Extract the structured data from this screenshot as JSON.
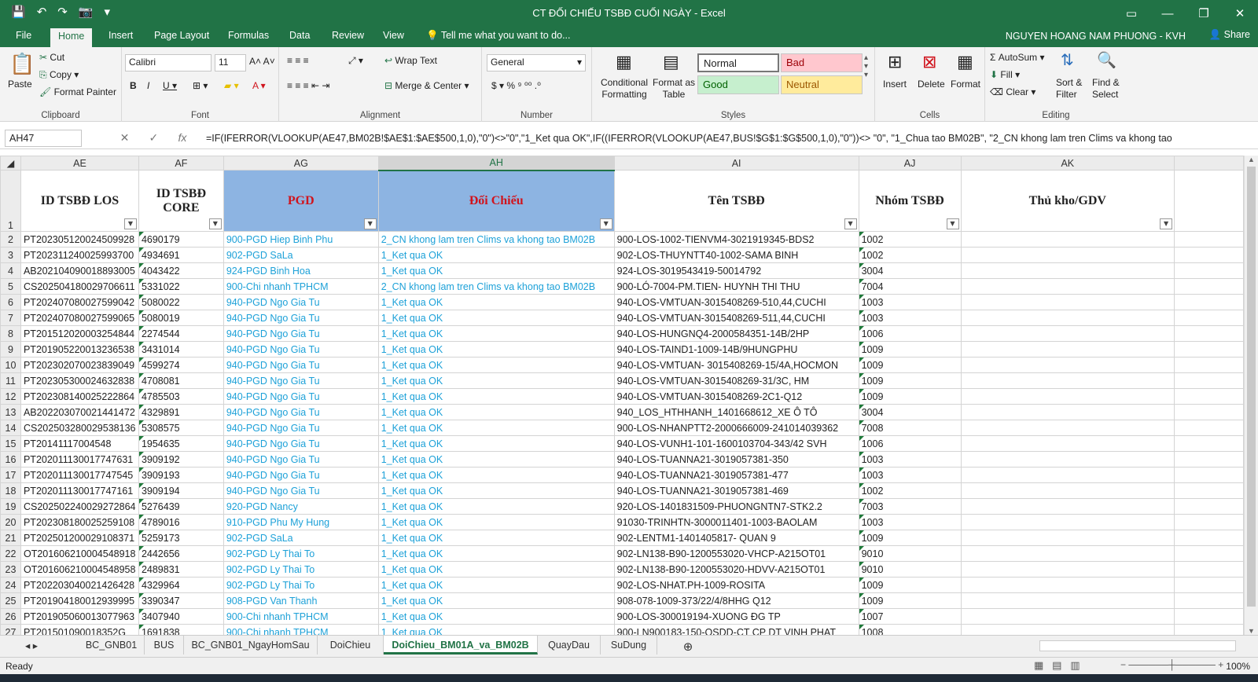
{
  "window": {
    "title": "CT ĐỐI CHIẾU TSBĐ CUỐI NGÀY - Excel"
  },
  "tabs": [
    "File",
    "Home",
    "Insert",
    "Page Layout",
    "Formulas",
    "Data",
    "Review",
    "View"
  ],
  "tell_me": "Tell me what you want to do...",
  "user": "NGUYEN HOANG NAM PHUONG - KVH",
  "share": "Share",
  "ribbon": {
    "clipboard": {
      "label": "Clipboard",
      "paste": "Paste",
      "cut": "Cut",
      "copy": "Copy",
      "format_painter": "Format Painter"
    },
    "font": {
      "label": "Font",
      "name": "Calibri",
      "size": "11"
    },
    "alignment": {
      "label": "Alignment",
      "wrap": "Wrap Text",
      "merge": "Merge & Center"
    },
    "number": {
      "label": "Number",
      "format": "General"
    },
    "styles": {
      "label": "Styles",
      "cond": "Conditional Formatting",
      "table": "Format as Table",
      "normal": "Normal",
      "bad": "Bad",
      "good": "Good",
      "neutral": "Neutral"
    },
    "cells": {
      "label": "Cells",
      "insert": "Insert",
      "delete": "Delete",
      "format": "Format"
    },
    "editing": {
      "label": "Editing",
      "autosum": "AutoSum",
      "fill": "Fill",
      "clear": "Clear",
      "sort": "Sort & Filter",
      "find": "Find & Select"
    }
  },
  "namebox": "AH47",
  "formula": "=IF(IFERROR(VLOOKUP(AE47,BM02B!$AE$1:$AE$500,1,0),\"0\")<>\"0\",\"1_Ket qua OK\",IF((IFERROR(VLOOKUP(AE47,BUS!$G$1:$G$500,1,0),\"0\"))<> \"0\", \"1_Chua tao BM02B\", \"2_CN khong lam tren Clims va khong tao",
  "columns": [
    "AE",
    "AF",
    "AG",
    "AH",
    "AI",
    "AJ",
    "AK"
  ],
  "headers": [
    "ID TSBĐ LOS",
    "ID TSBĐ CORE",
    "PGD",
    "Đối Chiếu",
    "Tên TSBĐ",
    "Nhóm TSBĐ",
    "Thủ kho/GDV"
  ],
  "rows": [
    [
      "PT202305120024509928",
      "4690179",
      "900-PGD Hiep Binh Phu",
      "2_CN khong lam tren Clims va khong tao BM02B",
      "900-LOS-1002-TIENVM4-3021919345-BDS2",
      "1002"
    ],
    [
      "PT202311240025993700",
      "4934691",
      "902-PGD SaLa",
      "1_Ket qua OK",
      "902-LOS-THUYNTT40-1002-SAMA BINH",
      "1002"
    ],
    [
      "AB202104090018893005",
      "4043422",
      "924-PGD Binh Hoa",
      "1_Ket qua OK",
      "924-LOS-3019543419-50014792",
      "3004"
    ],
    [
      "CS202504180029706611",
      "5331022",
      "900-Chi nhanh TPHCM",
      "2_CN khong lam tren Clims va khong tao BM02B",
      "900-LÓ-7004-PM.TIEN- HUYNH THI THU",
      "7004"
    ],
    [
      "PT202407080027599042",
      "5080022",
      "940-PGD Ngo Gia Tu",
      "1_Ket qua OK",
      "940-LOS-VMTUAN-3015408269-510,44,CUCHI",
      "1003"
    ],
    [
      "PT202407080027599065",
      "5080019",
      "940-PGD Ngo Gia Tu",
      "1_Ket qua OK",
      "940-LOS-VMTUAN-3015408269-511,44,CUCHI",
      "1003"
    ],
    [
      "PT201512020003254844",
      "2274544",
      "940-PGD Ngo Gia Tu",
      "1_Ket qua OK",
      "940-LOS-HUNGNQ4-2000584351-14B/2HP",
      "1006"
    ],
    [
      "PT201905220013236538",
      "3431014",
      "940-PGD Ngo Gia Tu",
      "1_Ket qua OK",
      "940-LOS-TAIND1-1009-14B/9HUNGPHU",
      "1009"
    ],
    [
      "PT202302070023839049",
      "4599274",
      "940-PGD Ngo Gia Tu",
      "1_Ket qua OK",
      "940-LOS-VMTUAN- 3015408269-15/4A,HOCMON",
      "1009"
    ],
    [
      "PT202305300024632838",
      "4708081",
      "940-PGD Ngo Gia Tu",
      "1_Ket qua OK",
      "940-LOS-VMTUAN-3015408269-31/3C, HM",
      "1009"
    ],
    [
      "PT202308140025222864",
      "4785503",
      "940-PGD Ngo Gia Tu",
      "1_Ket qua OK",
      "940-LOS-VMTUAN-3015408269-2C1-Q12",
      "1009"
    ],
    [
      "AB202203070021441472",
      "4329891",
      "940-PGD Ngo Gia Tu",
      "1_Ket qua OK",
      "940_LOS_HTHHANH_1401668612_XE Ô TÔ",
      "3004"
    ],
    [
      "CS202503280029538136",
      "5308575",
      "940-PGD Ngo Gia Tu",
      "1_Ket qua OK",
      "900-LOS-NHANPTT2-2000666009-241014039362",
      "7008"
    ],
    [
      "PT20141117004548",
      "1954635",
      "940-PGD Ngo Gia Tu",
      "1_Ket qua OK",
      "940-LOS-VUNH1-101-1600103704-343/42 SVH",
      "1006"
    ],
    [
      "PT202011130017747631",
      "3909192",
      "940-PGD Ngo Gia Tu",
      "1_Ket qua OK",
      "940-LOS-TUANNA21-3019057381-350",
      "1003"
    ],
    [
      "PT202011130017747545",
      "3909193",
      "940-PGD Ngo Gia Tu",
      "1_Ket qua OK",
      "940-LOS-TUANNA21-3019057381-477",
      "1003"
    ],
    [
      "PT202011130017747161",
      "3909194",
      "940-PGD Ngo Gia Tu",
      "1_Ket qua OK",
      "940-LOS-TUANNA21-3019057381-469",
      "1002"
    ],
    [
      "CS202502240029272864",
      "5276439",
      "920-PGD Nancy",
      "1_Ket qua OK",
      "920-LOS-1401831509-PHUONGNTN7-STK2.2",
      "7003"
    ],
    [
      "PT202308180025259108",
      "4789016",
      "910-PGD Phu My Hung",
      "1_Ket qua OK",
      "91030-TRINHTN-3000011401-1003-BAOLAM",
      "1003"
    ],
    [
      "PT202501200029108371",
      "5259173",
      "902-PGD SaLa",
      "1_Ket qua OK",
      "902-LENTM1-1401405817- QUAN 9",
      "1009"
    ],
    [
      "OT201606210004548918",
      "2442656",
      "902-PGD Ly Thai To",
      "1_Ket qua OK",
      "902-LN138-B90-1200553020-VHCP-A215OT01",
      "9010"
    ],
    [
      "OT201606210004548958",
      "2489831",
      "902-PGD Ly Thai To",
      "1_Ket qua OK",
      "902-LN138-B90-1200553020-HDVV-A215OT01",
      "9010"
    ],
    [
      "PT202203040021426428",
      "4329964",
      "902-PGD Ly Thai To",
      "1_Ket qua OK",
      "902-LOS-NHAT.PH-1009-ROSITA",
      "1009"
    ],
    [
      "PT201904180012939995",
      "3390347",
      "908-PGD Van Thanh",
      "1_Ket qua OK",
      "908-078-1009-373/22/4/8HHG Q12",
      "1009"
    ],
    [
      "PT201905060013077963",
      "3407940",
      "900-Chi nhanh TPHCM",
      "1_Ket qua OK",
      "900-LOS-300019194-XUONG ĐG TP",
      "1007"
    ],
    [
      "PT201501090018352G",
      "1691838",
      "900-Chi nhanh TPHCM",
      "1_Ket qua OK",
      "900-LN900183-150-QSDD-CT CP DT VINH PHAT",
      "1008"
    ]
  ],
  "sheets": [
    "BC_GNB01",
    "BUS",
    "BC_GNB01_NgayHomSau",
    "DoiChieu",
    "DoiChieu_BM01A_va_BM02B",
    "QuayDau",
    "SuDung"
  ],
  "status": "Ready",
  "zoom": "100%"
}
